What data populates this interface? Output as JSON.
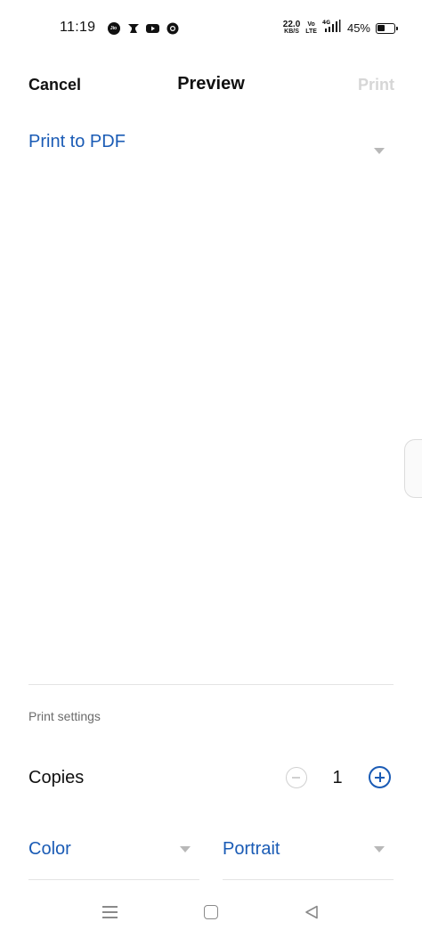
{
  "status_bar": {
    "time": "11:19",
    "net_speed_value": "22.0",
    "net_speed_unit": "KB/S",
    "volte_top": "Vo",
    "volte_bottom": "LTE",
    "network": "4G",
    "battery_percent": "45%",
    "battery_level": 0.45,
    "notification_icons": [
      "jio-icon",
      "stock-market-icon",
      "youtube-icon",
      "chrome-icon"
    ]
  },
  "toolbar": {
    "cancel_label": "Cancel",
    "title": "Preview",
    "print_label": "Print"
  },
  "printer": {
    "selected": "Print to PDF"
  },
  "settings": {
    "section_label": "Print settings",
    "copies_label": "Copies",
    "copies_value": "1",
    "color_value": "Color",
    "orientation_value": "Portrait"
  },
  "colors": {
    "accent": "#1a5bb5",
    "disabled": "#d6d6d6",
    "muted_text": "#6b6b6b",
    "divider": "#e4e4e4"
  },
  "nav_bar": {
    "icons": [
      "menu-icon",
      "home-icon",
      "back-icon"
    ]
  }
}
